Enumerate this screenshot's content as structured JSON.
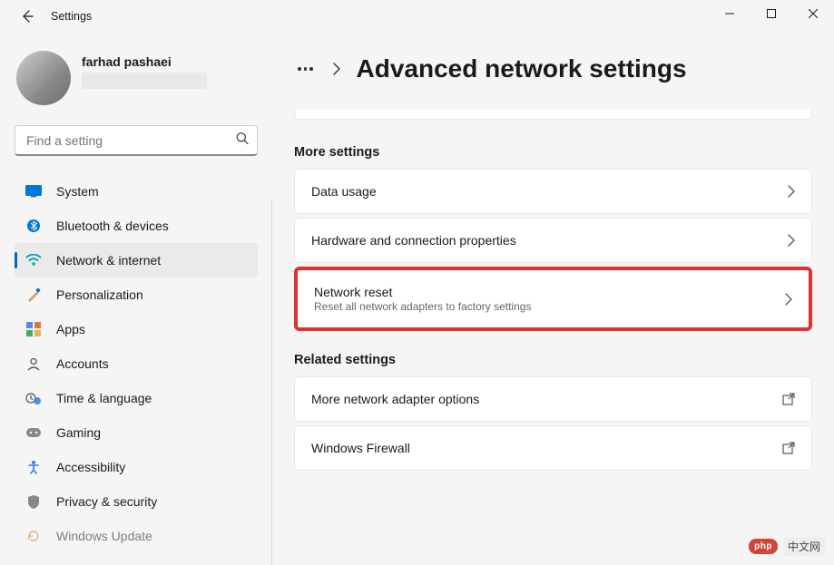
{
  "window": {
    "title": "Settings"
  },
  "profile": {
    "name": "farhad pashaei"
  },
  "search": {
    "placeholder": "Find a setting"
  },
  "sidebar": {
    "items": [
      {
        "label": "System"
      },
      {
        "label": "Bluetooth & devices"
      },
      {
        "label": "Network & internet"
      },
      {
        "label": "Personalization"
      },
      {
        "label": "Apps"
      },
      {
        "label": "Accounts"
      },
      {
        "label": "Time & language"
      },
      {
        "label": "Gaming"
      },
      {
        "label": "Accessibility"
      },
      {
        "label": "Privacy & security"
      },
      {
        "label": "Windows Update"
      }
    ]
  },
  "page": {
    "title": "Advanced network settings"
  },
  "section1": {
    "title": "More settings",
    "cards": [
      {
        "title": "Data usage"
      },
      {
        "title": "Hardware and connection properties"
      },
      {
        "title": "Network reset",
        "sub": "Reset all network adapters to factory settings"
      }
    ]
  },
  "section2": {
    "title": "Related settings",
    "cards": [
      {
        "title": "More network adapter options"
      },
      {
        "title": "Windows Firewall"
      }
    ]
  },
  "watermark": {
    "badge": "php",
    "text": "中文网"
  }
}
